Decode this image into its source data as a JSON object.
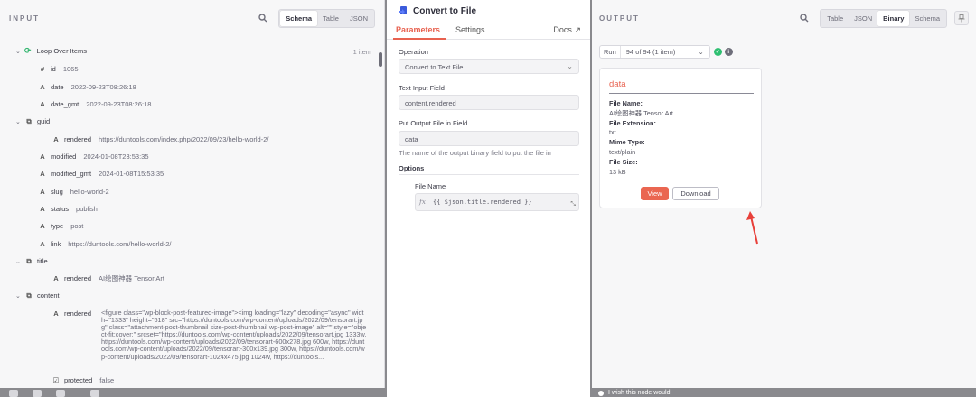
{
  "input": {
    "title": "INPUT",
    "views": [
      "Schema",
      "Table",
      "JSON"
    ],
    "active_view": "Schema",
    "loop_label": "Loop Over Items",
    "item_count": "1 item",
    "rows": [
      {
        "type": "#",
        "key": "id",
        "value": "1065"
      },
      {
        "type": "A",
        "key": "date",
        "value": "2022-09-23T08:26:18"
      },
      {
        "type": "A",
        "key": "date_gmt",
        "value": "2022-09-23T08:26:18"
      },
      {
        "type": "obj",
        "key": "guid",
        "value": ""
      },
      {
        "type": "A",
        "key": "rendered",
        "value": "https://duntools.com/index.php/2022/09/23/hello-world-2/"
      },
      {
        "type": "A",
        "key": "modified",
        "value": "2024-01-08T23:53:35"
      },
      {
        "type": "A",
        "key": "modified_gmt",
        "value": "2024-01-08T15:53:35"
      },
      {
        "type": "A",
        "key": "slug",
        "value": "hello-world-2"
      },
      {
        "type": "A",
        "key": "status",
        "value": "publish"
      },
      {
        "type": "A",
        "key": "type",
        "value": "post"
      },
      {
        "type": "A",
        "key": "link",
        "value": "https://duntools.com/hello-world-2/"
      },
      {
        "type": "obj",
        "key": "title",
        "value": ""
      },
      {
        "type": "A",
        "key": "rendered",
        "value": "AI绘图神器 Tensor Art"
      },
      {
        "type": "obj",
        "key": "content",
        "value": ""
      },
      {
        "type": "A",
        "key": "rendered",
        "value": ""
      },
      {
        "type": "bool",
        "key": "protected",
        "value": "false"
      }
    ],
    "content_rendered": "<figure class=\"wp-block-post-featured-image\"><img loading=\"lazy\" decoding=\"async\" width=\"1333\" height=\"618\" src=\"https://duntools.com/wp-content/uploads/2022/09/tensorart.jpg\" class=\"attachment-post-thumbnail size-post-thumbnail wp-post-image\" alt=\"\" style=\"object-fit:cover;\" srcset=\"https://duntools.com/wp-content/uploads/2022/09/tensorart.jpg 1333w, https://duntools.com/wp-content/uploads/2022/09/tensorart-600x278.jpg 600w, https://duntools.com/wp-content/uploads/2022/09/tensorart-300x139.jpg 300w, https://duntools.com/wp-content/uploads/2022/09/tensorart-1024x475.jpg 1024w, https://duntools..."
  },
  "node": {
    "title": "Convert to File",
    "tabs": {
      "parameters": "Parameters",
      "settings": "Settings",
      "docs": "Docs"
    },
    "operation_label": "Operation",
    "operation_value": "Convert to Text File",
    "text_input_label": "Text Input Field",
    "text_input_value": "content.rendered",
    "output_field_label": "Put Output File in Field",
    "output_field_value": "data",
    "output_field_hint": "The name of the output binary field to put the file in",
    "options_label": "Options",
    "file_name_label": "File Name",
    "file_name_value": "{{ $json.title.rendered }}"
  },
  "output": {
    "title": "OUTPUT",
    "views": [
      "Table",
      "JSON",
      "Binary",
      "Schema"
    ],
    "active_view": "Binary",
    "run_label": "Run",
    "run_value": "94 of 94 (1 item)",
    "binary": {
      "name": "data",
      "file_name_label": "File Name:",
      "file_name": "AI绘图神器 Tensor Art",
      "ext_label": "File Extension:",
      "ext": "txt",
      "mime_label": "Mime Type:",
      "mime": "text/plain",
      "size_label": "File Size:",
      "size": "13 kB",
      "view_label": "View",
      "download_label": "Download"
    }
  },
  "feedback": "I wish this node would",
  "colors": {
    "accent": "#e8614f",
    "success": "#2fbf71"
  }
}
